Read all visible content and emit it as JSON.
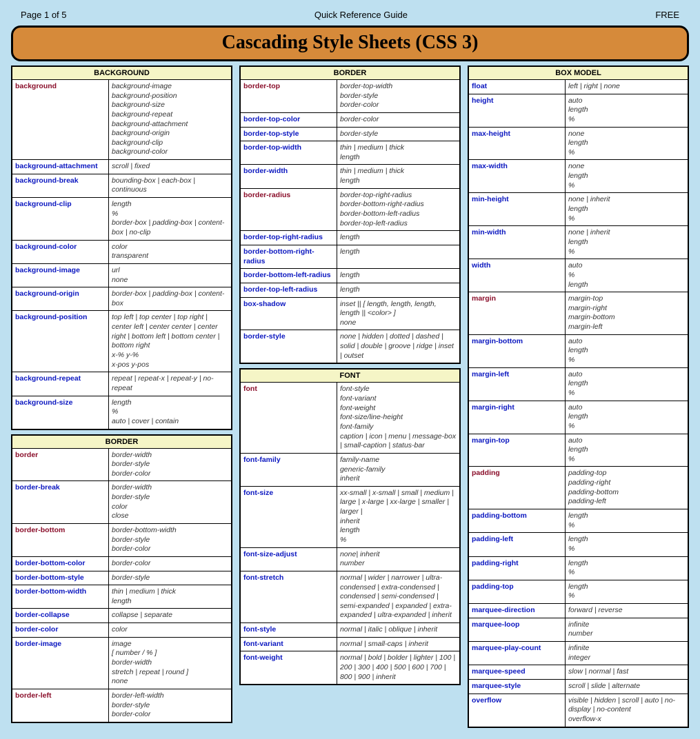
{
  "header": {
    "page": "Page 1 of 5",
    "center": "Quick Reference Guide",
    "right": "FREE",
    "title": "Cascading Style Sheets (CSS 3)"
  },
  "columns": [
    {
      "panels": [
        {
          "title": "BACKGROUND",
          "rows": [
            {
              "prop": "background",
              "kind": "shorthand",
              "vals": "background-image\nbackground-position\nbackground-size\nbackground-repeat\nbackground-attachment\nbackground-origin\nbackground-clip\nbackground-color"
            },
            {
              "prop": "background-attachment",
              "kind": "longhand",
              "vals": "scroll | fixed"
            },
            {
              "prop": "background-break",
              "kind": "longhand",
              "vals": "bounding-box | each-box | continuous"
            },
            {
              "prop": "background-clip",
              "kind": "longhand",
              "vals": "length\n%\nborder-box | padding-box | content-box | no-clip"
            },
            {
              "prop": "background-color",
              "kind": "longhand",
              "vals": "color\ntransparent"
            },
            {
              "prop": "background-image",
              "kind": "longhand",
              "vals": "url\nnone"
            },
            {
              "prop": "background-origin",
              "kind": "longhand",
              "vals": "border-box | padding-box | content-box"
            },
            {
              "prop": "background-position",
              "kind": "longhand",
              "vals": "top left | top center | top right | center left | center center | center right | bottom left | bottom center | bottom right\nx-% y-%\nx-pos y-pos"
            },
            {
              "prop": "background-repeat",
              "kind": "longhand",
              "vals": "repeat | repeat-x | repeat-y | no-repeat"
            },
            {
              "prop": "background-size",
              "kind": "longhand",
              "vals": "length\n%\nauto | cover | contain"
            }
          ]
        },
        {
          "title": "BORDER",
          "rows": [
            {
              "prop": "border",
              "kind": "shorthand",
              "vals": "border-width\nborder-style\nborder-color"
            },
            {
              "prop": "border-break",
              "kind": "longhand",
              "vals": "border-width\nborder-style\ncolor\nclose"
            },
            {
              "prop": "border-bottom",
              "kind": "shorthand",
              "vals": "border-bottom-width\nborder-style\nborder-color"
            },
            {
              "prop": "border-bottom-color",
              "kind": "longhand",
              "vals": "border-color"
            },
            {
              "prop": "border-bottom-style",
              "kind": "longhand",
              "vals": "border-style"
            },
            {
              "prop": "border-bottom-width",
              "kind": "longhand",
              "vals": "thin | medium | thick\nlength"
            },
            {
              "prop": "border-collapse",
              "kind": "longhand",
              "vals": "collapse | separate"
            },
            {
              "prop": "border-color",
              "kind": "longhand",
              "vals": "color"
            },
            {
              "prop": "border-image",
              "kind": "longhand",
              "vals": "image\n[ number / % ]\nborder-width\nstretch | repeat | round ]\nnone"
            },
            {
              "prop": "border-left",
              "kind": "shorthand",
              "vals": "border-left-width\nborder-style\nborder-color"
            }
          ]
        }
      ]
    },
    {
      "panels": [
        {
          "title": "BORDER",
          "rows": [
            {
              "prop": "border-top",
              "kind": "shorthand",
              "vals": "border-top-width\nborder-style\nborder-color"
            },
            {
              "prop": "border-top-color",
              "kind": "longhand",
              "vals": "border-color"
            },
            {
              "prop": "border-top-style",
              "kind": "longhand",
              "vals": "border-style"
            },
            {
              "prop": "border-top-width",
              "kind": "longhand",
              "vals": "thin | medium | thick\nlength"
            },
            {
              "prop": "border-width",
              "kind": "longhand",
              "vals": "thin | medium | thick\nlength"
            },
            {
              "prop": "border-radius",
              "kind": "shorthand",
              "vals": "border-top-right-radius\nborder-bottom-right-radius\nborder-bottom-left-radius\nborder-top-left-radius"
            },
            {
              "prop": "border-top-right-radius",
              "kind": "longhand",
              "vals": "length"
            },
            {
              "prop": "border-bottom-right-radius",
              "kind": "longhand",
              "vals": "length"
            },
            {
              "prop": "border-bottom-left-radius",
              "kind": "longhand",
              "vals": "length"
            },
            {
              "prop": "border-top-left-radius",
              "kind": "longhand",
              "vals": "length"
            },
            {
              "prop": "box-shadow",
              "kind": "longhand",
              "vals": "inset || [ length, length, length, length || <color> ]\nnone"
            },
            {
              "prop": "border-style",
              "kind": "longhand",
              "vals": "none | hidden | dotted | dashed | solid | double | groove | ridge | inset | outset"
            }
          ]
        },
        {
          "title": "FONT",
          "rows": [
            {
              "prop": "font",
              "kind": "shorthand",
              "vals": "font-style\nfont-variant\nfont-weight\nfont-size/line-height\nfont-family\ncaption | icon | menu | message-box | small-caption | status-bar"
            },
            {
              "prop": "font-family",
              "kind": "longhand",
              "vals": "family-name\ngeneric-family\ninherit"
            },
            {
              "prop": "font-size",
              "kind": "longhand",
              "vals": "xx-small | x-small | small | medium | large | x-large | xx-large | smaller | larger |\ninherit\nlength\n%"
            },
            {
              "prop": "font-size-adjust",
              "kind": "longhand",
              "vals": "none| inherit\nnumber"
            },
            {
              "prop": "font-stretch",
              "kind": "longhand",
              "vals": "normal | wider | narrower | ultra-condensed | extra-condensed | condensed | semi-condensed | semi-expanded | expanded | extra-expanded | ultra-expanded | inherit"
            },
            {
              "prop": "font-style",
              "kind": "longhand",
              "vals": "normal | italic | oblique | inherit"
            },
            {
              "prop": "font-variant",
              "kind": "longhand",
              "vals": "normal | small-caps | inherit"
            },
            {
              "prop": "font-weight",
              "kind": "longhand",
              "vals": "normal | bold | bolder | lighter | 100 | 200 | 300 | 400 | 500 | 600 | 700 | 800 | 900 | inherit"
            }
          ]
        }
      ]
    },
    {
      "panels": [
        {
          "title": "BOX MODEL",
          "rows": [
            {
              "prop": "float",
              "kind": "longhand",
              "vals": "left | right | none"
            },
            {
              "prop": "height",
              "kind": "longhand",
              "vals": "auto\nlength\n%"
            },
            {
              "prop": "max-height",
              "kind": "longhand",
              "vals": "none\nlength\n%"
            },
            {
              "prop": "max-width",
              "kind": "longhand",
              "vals": "none\nlength\n%"
            },
            {
              "prop": "min-height",
              "kind": "longhand",
              "vals": "none | inherit\nlength\n%"
            },
            {
              "prop": "min-width",
              "kind": "longhand",
              "vals": "none | inherit\nlength\n%"
            },
            {
              "prop": "width",
              "kind": "longhand",
              "vals": "auto\n%\nlength"
            },
            {
              "prop": "margin",
              "kind": "shorthand",
              "vals": "margin-top\nmargin-right\nmargin-bottom\nmargin-left"
            },
            {
              "prop": "margin-bottom",
              "kind": "longhand",
              "vals": "auto\nlength\n%"
            },
            {
              "prop": "margin-left",
              "kind": "longhand",
              "vals": "auto\nlength\n%"
            },
            {
              "prop": "margin-right",
              "kind": "longhand",
              "vals": "auto\nlength\n%"
            },
            {
              "prop": "margin-top",
              "kind": "longhand",
              "vals": "auto\nlength\n%"
            },
            {
              "prop": "padding",
              "kind": "shorthand",
              "vals": "padding-top\npadding-right\npadding-bottom\npadding-left"
            },
            {
              "prop": "padding-bottom",
              "kind": "longhand",
              "vals": "length\n%"
            },
            {
              "prop": "padding-left",
              "kind": "longhand",
              "vals": "length\n%"
            },
            {
              "prop": "padding-right",
              "kind": "longhand",
              "vals": "length\n%"
            },
            {
              "prop": "padding-top",
              "kind": "longhand",
              "vals": "length\n%"
            },
            {
              "prop": "marquee-direction",
              "kind": "longhand",
              "vals": "forward | reverse"
            },
            {
              "prop": "marquee-loop",
              "kind": "longhand",
              "vals": "infinite\nnumber"
            },
            {
              "prop": "marquee-play-count",
              "kind": "longhand",
              "vals": "infinite\ninteger"
            },
            {
              "prop": "marquee-speed",
              "kind": "longhand",
              "vals": "slow | normal | fast"
            },
            {
              "prop": "marquee-style",
              "kind": "longhand",
              "vals": "scroll | slide | alternate"
            },
            {
              "prop": "overflow",
              "kind": "longhand",
              "vals": "visible | hidden | scroll | auto | no-display | no-content\noverflow-x"
            }
          ]
        }
      ]
    }
  ]
}
